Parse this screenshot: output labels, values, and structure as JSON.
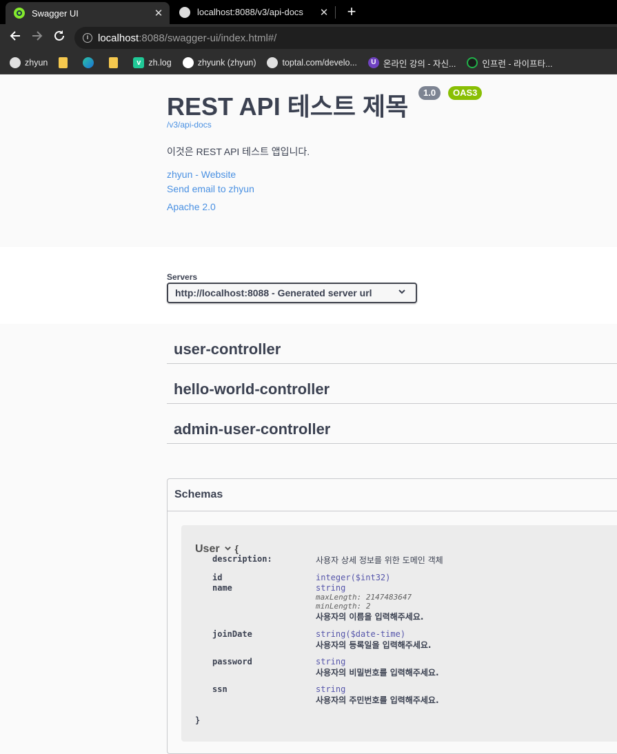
{
  "browser": {
    "tabs": [
      {
        "title": "Swagger UI",
        "active": true
      },
      {
        "title": "localhost:8088/v3/api-docs",
        "active": false
      }
    ],
    "close_glyph": "✕",
    "new_tab_glyph": "+",
    "url_host": "localhost",
    "url_rest": ":8088/swagger-ui/index.html#/",
    "bookmarks": [
      {
        "icon": "globe-icon",
        "label": "zhyun"
      },
      {
        "icon": "folder-icon",
        "label": ""
      },
      {
        "icon": "edge-icon",
        "label": ""
      },
      {
        "icon": "folder-icon",
        "label": ""
      },
      {
        "icon": "v-icon",
        "label": "zh.log"
      },
      {
        "icon": "github-icon",
        "label": "zhyunk (zhyun)"
      },
      {
        "icon": "globe-icon",
        "label": "toptal.com/develo..."
      },
      {
        "icon": "udemy-icon",
        "label": "온라인 강의 - 자신..."
      },
      {
        "icon": "inflearn-icon",
        "label": "인프런 - 라이프타..."
      }
    ]
  },
  "info": {
    "title": "REST API 테스트 제목",
    "version": "1.0",
    "oas": "OAS3",
    "api_link": "/v3/api-docs",
    "description": "이것은 REST API 테스트 앱입니다.",
    "links": [
      "zhyun - Website",
      "Send email to zhyun",
      "Apache 2.0"
    ]
  },
  "servers": {
    "label": "Servers",
    "selected": "http://localhost:8088 - Generated server url"
  },
  "tags": [
    "user-controller",
    "hello-world-controller",
    "admin-user-controller"
  ],
  "schemas": {
    "heading": "Schemas",
    "model": {
      "name": "User",
      "open_brace": "{",
      "close_brace": "}",
      "description_label": "description:",
      "description": "사용자 상세 정보를 위한 도메인 객체",
      "properties": [
        {
          "name": "id",
          "type": "integer($int32)",
          "meta": [],
          "desc": ""
        },
        {
          "name": "name",
          "type": "string",
          "meta": [
            "maxLength: 2147483647",
            "minLength: 2"
          ],
          "desc": "사용자의 이름을 입력해주세요."
        },
        {
          "name": "joinDate",
          "type": "string($date-time)",
          "meta": [],
          "desc": "사용자의 등록일을 입력해주세요."
        },
        {
          "name": "password",
          "type": "string",
          "meta": [],
          "desc": "사용자의 비밀번호를 입력해주세요."
        },
        {
          "name": "ssn",
          "type": "string",
          "meta": [],
          "desc": "사용자의 주민번호를 입력해주세요."
        }
      ]
    }
  }
}
